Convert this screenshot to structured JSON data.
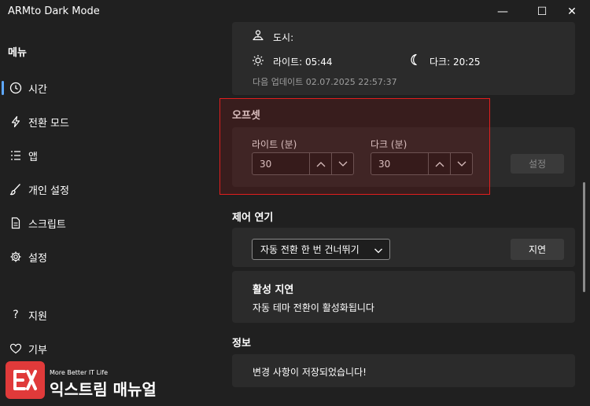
{
  "window": {
    "title": "ARMto Dark Mode",
    "controls": {
      "minimize": "—",
      "maximize": "☐",
      "close": "✕"
    }
  },
  "sidebar": {
    "menu_label": "메뉴",
    "items": [
      {
        "label": "시간",
        "icon": "clock-icon"
      },
      {
        "label": "전환 모드",
        "icon": "lightning-icon"
      },
      {
        "label": "앱",
        "icon": "list-icon"
      },
      {
        "label": "개인 설정",
        "icon": "brush-icon"
      },
      {
        "label": "스크립트",
        "icon": "document-icon"
      },
      {
        "label": "설정",
        "icon": "gear-icon"
      }
    ],
    "bottom_items": [
      {
        "label": "지원",
        "icon": "question-icon"
      },
      {
        "label": "기부",
        "icon": "heart-icon"
      }
    ],
    "accent": "#5ea8ff"
  },
  "location_card": {
    "city_label": "도시:",
    "light_label": "라이트: 05:44",
    "dark_label": "다크: 20:25",
    "next_update": "다음 업데이트 02.07.2025 22:57:37"
  },
  "offset": {
    "section_title": "오프셋",
    "light_label": "라이트 (분)",
    "light_value": "30",
    "dark_label": "다크 (분)",
    "dark_value": "30",
    "set_button": "설정",
    "highlight_color": "#e21e1e"
  },
  "delay": {
    "section_title": "제어 연기",
    "dropdown_value": "자동 전환 한 번 건너뛰기",
    "delay_button": "지연",
    "status_title": "활성 지연",
    "status_text": "자동 테마 전환이 활성화됩니다"
  },
  "info": {
    "section_title": "정보",
    "message": "변경 사항이 저장되었습니다!"
  },
  "watermark": {
    "small_text": "More Better IT Life",
    "brand_text": "익스트림 매뉴얼"
  }
}
